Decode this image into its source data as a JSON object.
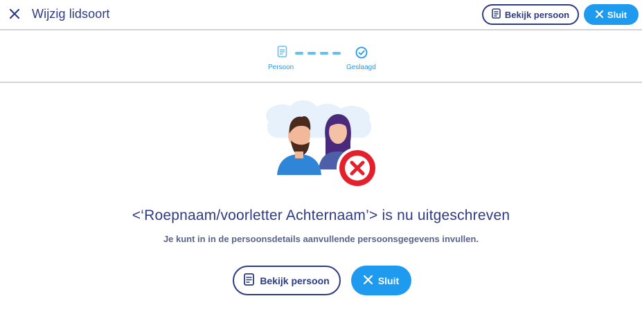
{
  "header": {
    "title": "Wijzig lidsoort",
    "close_icon": "close-icon",
    "view_person_label": "Bekijk persoon",
    "close_label": "Sluit"
  },
  "stepper": {
    "steps": [
      {
        "label": "Persoon",
        "icon": "document-icon"
      },
      {
        "label": "Geslaagd",
        "icon": "check-circle-icon"
      }
    ]
  },
  "message": {
    "title": "<‘Roepnaam/voorletter Achternaam’> is nu uitgeschreven",
    "subtitle": "Je kunt in in de persoonsdetails aanvullende persoonsgegevens invullen."
  },
  "actions": {
    "view_person_label": "Bekijk persoon",
    "close_label": "Sluit"
  },
  "colors": {
    "primary_navy": "#2d3a84",
    "accent_blue": "#1e9bef",
    "error_red": "#e3202b",
    "divider": "#d4d4d8"
  }
}
